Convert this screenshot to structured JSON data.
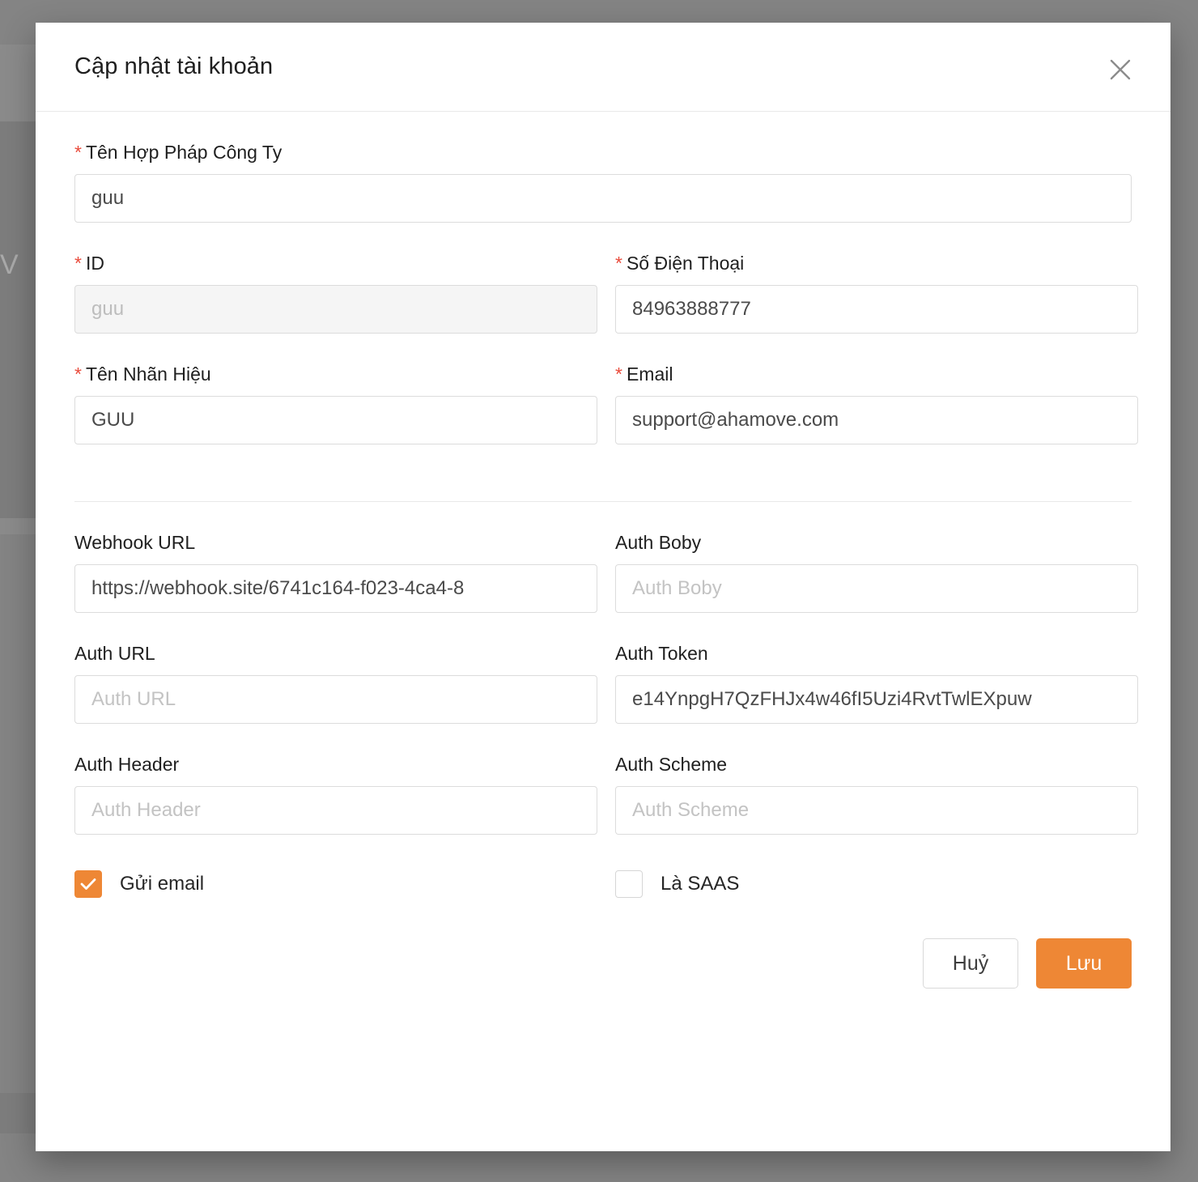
{
  "modal": {
    "title": "Cập nhật tài khoản",
    "close_icon": "close-icon"
  },
  "form": {
    "company_legal_name": {
      "label": "Tên Hợp Pháp Công Ty",
      "required_mark": "*",
      "value": "guu"
    },
    "id": {
      "label": "ID",
      "required_mark": "*",
      "value": "guu",
      "disabled": true
    },
    "phone": {
      "label": "Số Điện Thoại",
      "required_mark": "*",
      "value": "84963888777"
    },
    "brand_name": {
      "label": "Tên Nhãn Hiệu",
      "required_mark": "*",
      "value": "GUU"
    },
    "email": {
      "label": "Email",
      "required_mark": "*",
      "value": "support@ahamove.com"
    },
    "webhook_url": {
      "label": "Webhook URL",
      "value": "https://webhook.site/6741c164-f023-4ca4-8"
    },
    "auth_body": {
      "label": "Auth Boby",
      "placeholder": "Auth Boby",
      "value": ""
    },
    "auth_url": {
      "label": "Auth URL",
      "placeholder": "Auth URL",
      "value": ""
    },
    "auth_token": {
      "label": "Auth Token",
      "value": "e14YnpgH7QzFHJx4w46fI5Uzi4RvtTwlEXpuw"
    },
    "auth_header": {
      "label": "Auth Header",
      "placeholder": "Auth Header",
      "value": ""
    },
    "auth_scheme": {
      "label": "Auth Scheme",
      "placeholder": "Auth Scheme",
      "value": ""
    },
    "send_email": {
      "label": "Gửi email",
      "checked": true
    },
    "is_saas": {
      "label": "Là SAAS",
      "checked": false
    }
  },
  "footer": {
    "cancel_label": "Huỷ",
    "save_label": "Lưu"
  },
  "colors": {
    "accent": "#ee8735",
    "required": "#e94b3c",
    "backdrop": "#848484",
    "border": "#dcdcdc",
    "disabled_bg": "#f5f5f5"
  },
  "backdrop": {
    "glyph": "V"
  }
}
